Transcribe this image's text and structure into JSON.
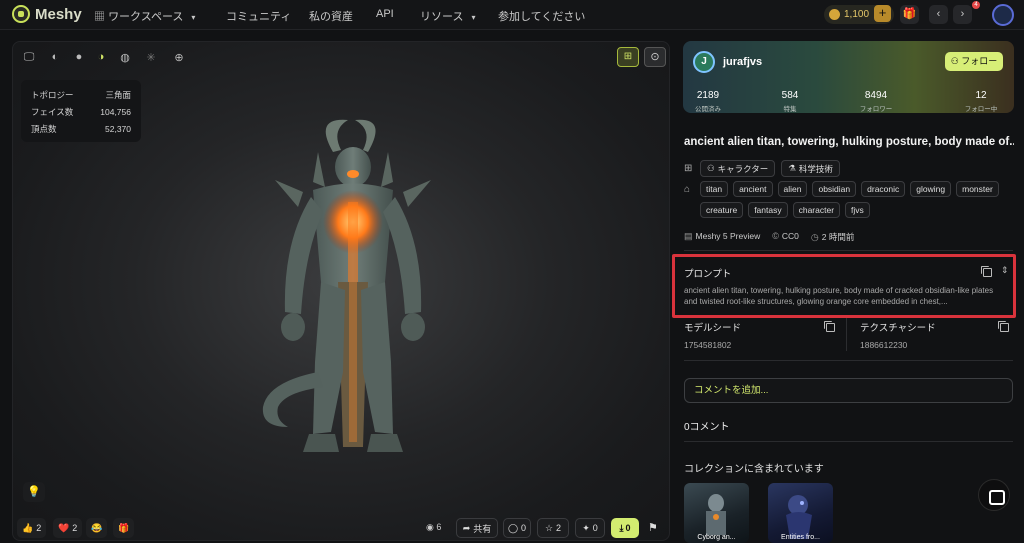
{
  "header": {
    "logo_text": "Meshy",
    "nav": [
      "ワークスペース",
      "コミュニティ",
      "私の資産",
      "API",
      "リソース",
      "参加してください"
    ],
    "coins": "1,100",
    "notification_count": "4"
  },
  "viewer": {
    "stats": [
      {
        "label": "トポロジー",
        "value": "三角面"
      },
      {
        "label": "フェイス数",
        "value": "104,756"
      },
      {
        "label": "頂点数",
        "value": "52,370"
      }
    ],
    "reactions": [
      {
        "icon": "👍",
        "count": "2"
      },
      {
        "icon": "❤️",
        "count": "2"
      },
      {
        "icon": "😂",
        "count": ""
      },
      {
        "icon": "🎁",
        "count": ""
      }
    ],
    "views": "6",
    "share_label": "共有",
    "comment_count": "0",
    "star_count": "2",
    "remix_count": "0",
    "download_count": "0"
  },
  "profile": {
    "avatar_letter": "J",
    "username": "jurafjvs",
    "follow_label": "フォロー",
    "stats": [
      {
        "value": "2189",
        "label": "公開済み"
      },
      {
        "value": "584",
        "label": "特集"
      },
      {
        "value": "8494",
        "label": "フォロワー"
      },
      {
        "value": "12",
        "label": "フォロー中"
      }
    ]
  },
  "model": {
    "title": "ancient alien titan, towering, hulking posture, body made of...",
    "categories": [
      "キャラクター",
      "科学技術"
    ],
    "tags": [
      "titan",
      "ancient",
      "alien",
      "obsidian",
      "draconic",
      "glowing",
      "monster",
      "creature",
      "fantasy",
      "character",
      "fjvs"
    ],
    "engine": "Meshy 5 Preview",
    "license": "CC0",
    "time": "2 時間前"
  },
  "prompt": {
    "label": "プロンプト",
    "text": "ancient alien titan, towering, hulking posture, body made of cracked obsidian-like plates and twisted root-like structures, glowing orange core embedded in chest,..."
  },
  "seeds": {
    "model_label": "モデルシード",
    "model_value": "1754581802",
    "texture_label": "テクスチャシード",
    "texture_value": "1886612230"
  },
  "comments": {
    "placeholder": "コメントを追加...",
    "count_label": "0コメント"
  },
  "collections": {
    "title": "コレクションに含まれています",
    "items": [
      "Cyborg an...",
      "Entities fro..."
    ]
  }
}
